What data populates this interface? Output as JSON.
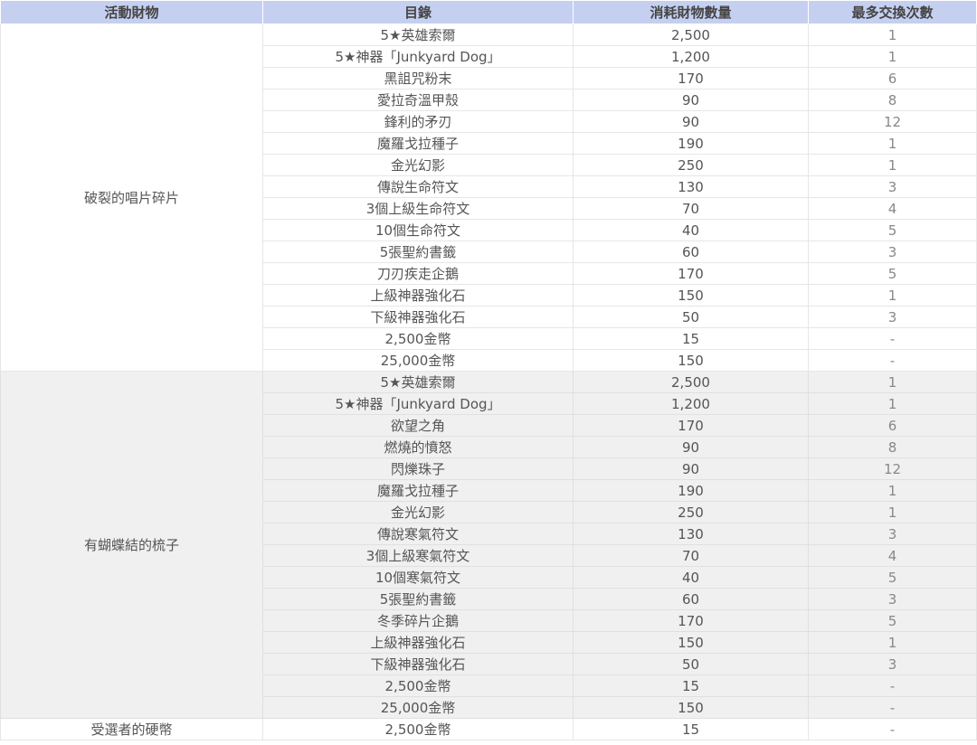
{
  "headers": [
    "活動財物",
    "目錄",
    "消耗財物數量",
    "最多交換次數"
  ],
  "groups": [
    {
      "name": "破裂的唱片碎片",
      "rows": [
        [
          "5★英雄索爾",
          "2,500",
          "1"
        ],
        [
          "5★神器「Junkyard Dog」",
          "1,200",
          "1"
        ],
        [
          "黑詛咒粉末",
          "170",
          "6"
        ],
        [
          "愛拉奇溫甲殼",
          "90",
          "8"
        ],
        [
          "鋒利的矛刃",
          "90",
          "12"
        ],
        [
          "魔羅戈拉種子",
          "190",
          "1"
        ],
        [
          "金光幻影",
          "250",
          "1"
        ],
        [
          "傳說生命符文",
          "130",
          "3"
        ],
        [
          "3個上級生命符文",
          "70",
          "4"
        ],
        [
          "10個生命符文",
          "40",
          "5"
        ],
        [
          "5張聖約書籤",
          "60",
          "3"
        ],
        [
          "刀刃疾走企鵝",
          "170",
          "5"
        ],
        [
          "上級神器強化石",
          "150",
          "1"
        ],
        [
          "下級神器強化石",
          "50",
          "3"
        ],
        [
          "2,500金幣",
          "15",
          "-"
        ],
        [
          "25,000金幣",
          "150",
          "-"
        ]
      ]
    },
    {
      "name": "有蝴蝶結的梳子",
      "rows": [
        [
          "5★英雄索爾",
          "2,500",
          "1"
        ],
        [
          "5★神器「Junkyard Dog」",
          "1,200",
          "1"
        ],
        [
          "欲望之角",
          "170",
          "6"
        ],
        [
          "燃燒的憤怒",
          "90",
          "8"
        ],
        [
          "閃爍珠子",
          "90",
          "12"
        ],
        [
          "魔羅戈拉種子",
          "190",
          "1"
        ],
        [
          "金光幻影",
          "250",
          "1"
        ],
        [
          "傳說寒氣符文",
          "130",
          "3"
        ],
        [
          "3個上級寒氣符文",
          "70",
          "4"
        ],
        [
          "10個寒氣符文",
          "40",
          "5"
        ],
        [
          "5張聖約書籤",
          "60",
          "3"
        ],
        [
          "冬季碎片企鵝",
          "170",
          "5"
        ],
        [
          "上級神器強化石",
          "150",
          "1"
        ],
        [
          "下級神器強化石",
          "50",
          "3"
        ],
        [
          "2,500金幣",
          "15",
          "-"
        ],
        [
          "25,000金幣",
          "150",
          "-"
        ]
      ]
    },
    {
      "name": "受選者的硬幣",
      "rows": [
        [
          "2,500金幣",
          "15",
          "-"
        ]
      ]
    }
  ]
}
